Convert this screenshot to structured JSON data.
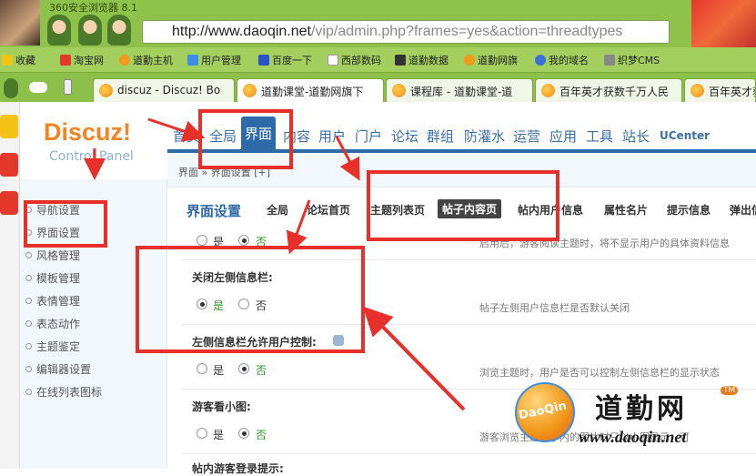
{
  "browser": {
    "title": "360安全浏览器 8.1",
    "url_host": "http://www.daoqin.net",
    "url_path": "/vip/admin.php?frames=yes&action=threadtypes",
    "favorites": [
      "收藏",
      "淘宝网",
      "道勤主机",
      "用户管理",
      "百度一下",
      "西部数码",
      "道勤数据",
      "道勤网旗",
      "我的域名",
      "织梦CMS"
    ],
    "tabs": [
      "discuz - Discuz! Bo",
      "道勤课堂-道勤网旗下",
      "课程库 - 道勤课堂-道",
      "百年英才获数千万人民",
      "百年英才获"
    ]
  },
  "logo": {
    "brand": "Discuz!",
    "sub": "Control Panel"
  },
  "topnav": [
    "首页",
    "全局",
    "界面",
    "内容",
    "用户",
    "门户",
    "论坛",
    "群组",
    "防灌水",
    "运营",
    "应用",
    "工具",
    "站长",
    "UCenter"
  ],
  "breadcrumb": "界面 » 界面设置  [+]",
  "sidebar": [
    "导航设置",
    "界面设置",
    "风格管理",
    "模板管理",
    "表情管理",
    "表态动作",
    "主题鉴定",
    "编辑器设置",
    "在线列表图标"
  ],
  "subtabs": {
    "title": "界面设置",
    "items": [
      "全局",
      "论坛首页",
      "主题列表页",
      "帖子内容页",
      "帖内用户信息",
      "属性名片",
      "提示信息",
      "弹出信"
    ]
  },
  "rows": {
    "r0": {
      "yes": "是",
      "no": "否",
      "desc": "启用后，游客阅读主题时，将不显示用户的具体资料信息"
    },
    "r1": {
      "label": "关闭左侧信息栏:",
      "yes": "是",
      "no": "否",
      "desc": "帖子左侧用户信息栏是否默认关闭"
    },
    "r2": {
      "label": "左侧信息栏允许用户控制:",
      "yes": "是",
      "no": "否",
      "desc": "浏览主题时，用户是否可以控制左侧信息栏的显示状态"
    },
    "r3": {
      "label": "游客看小图:",
      "yes": "是",
      "no": "否",
      "desc": "游客浏览主题帖子内的图片时只以小图显示，可"
    },
    "r4": {
      "label": "帖内游客登录提示:"
    }
  },
  "watermark": {
    "badge": "DaoQin",
    "brand": "道勤网",
    "tm": "TM",
    "url": "www.daoqin.net"
  }
}
